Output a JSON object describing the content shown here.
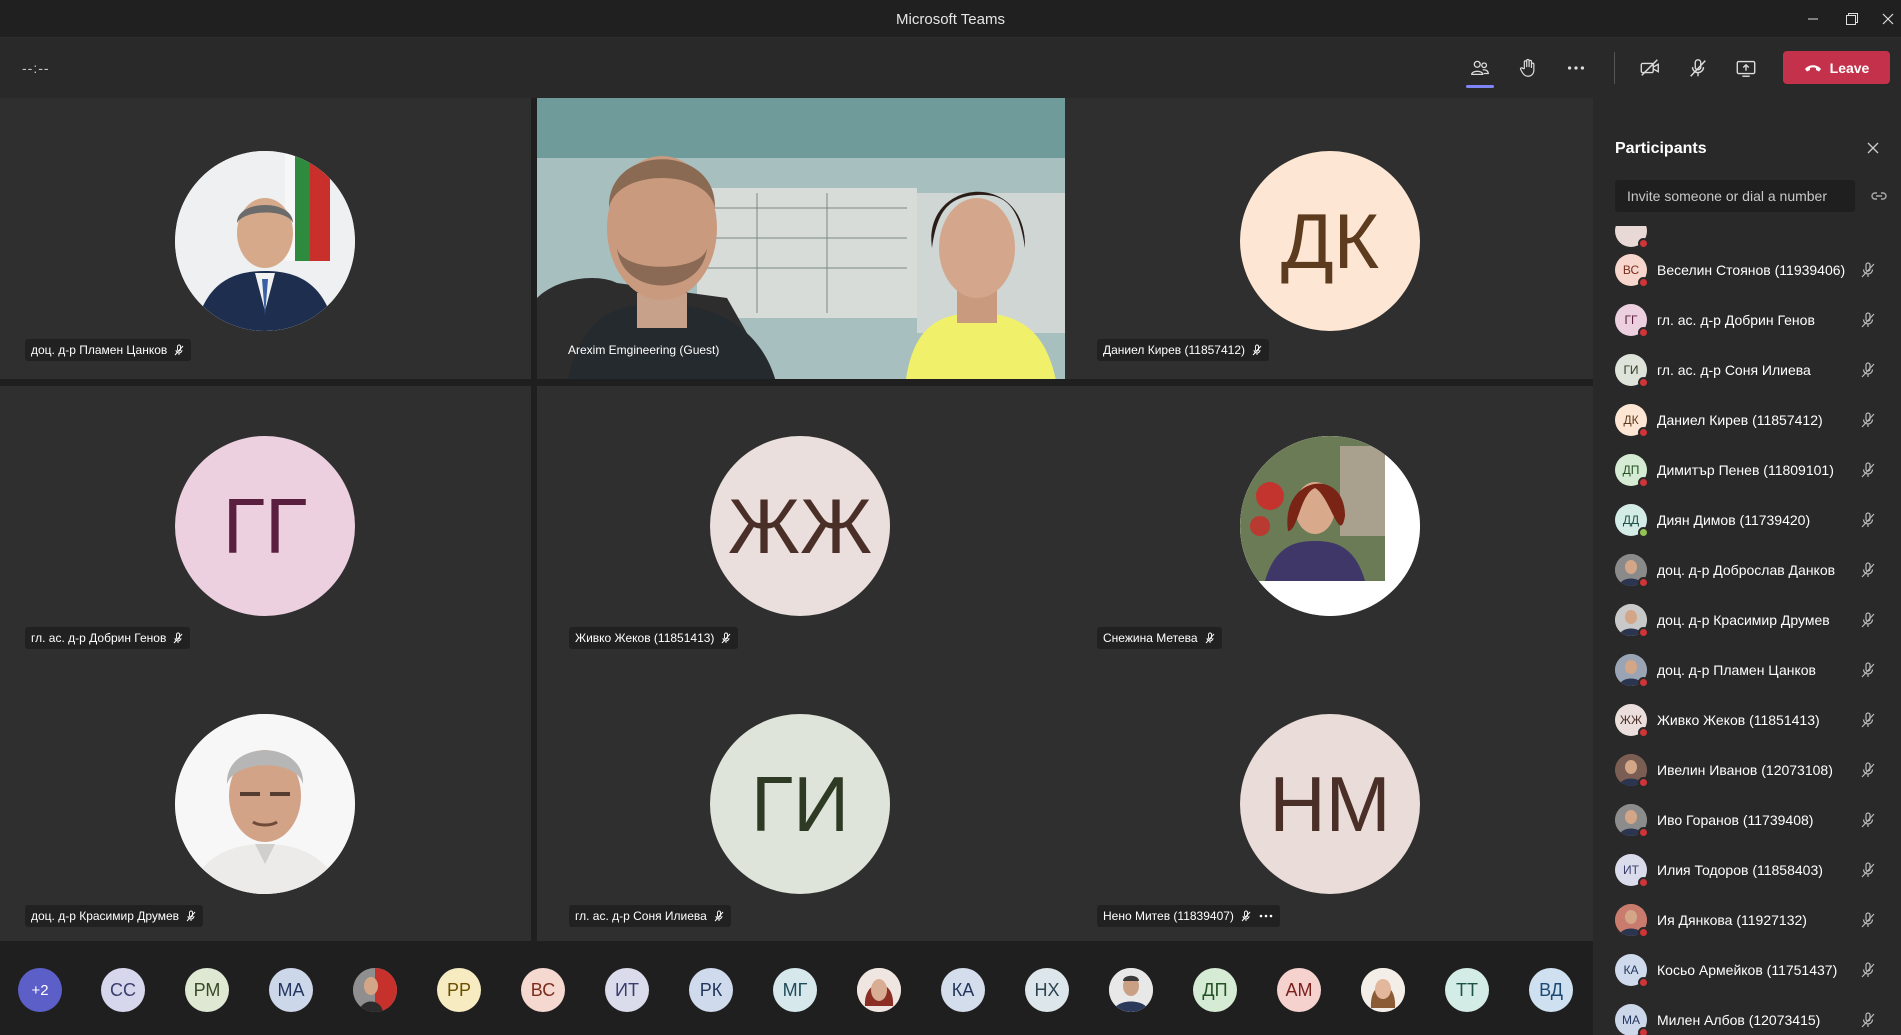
{
  "window": {
    "title": "Microsoft Teams"
  },
  "toolbar": {
    "timer": "--:--",
    "leave_label": "Leave"
  },
  "tiles": [
    {
      "name": "доц. д-р Пламен Цанков",
      "type": "photo"
    },
    {
      "name": "Arexim Emgineering (Guest)",
      "type": "video"
    },
    {
      "name": "Даниел Кирев (11857412)",
      "initials": "ДК",
      "bg": "#fde7d4",
      "fg": "#5c3b1e"
    },
    {
      "name": "гл. ас. д-р Добрин Генов",
      "initials": "ГГ",
      "bg": "#ecd0e0",
      "fg": "#5a1f3e"
    },
    {
      "name": "Живко Жеков (11851413)",
      "initials": "ЖЖ",
      "bg": "#eadfdc",
      "fg": "#4a2f28"
    },
    {
      "name": "Снежина Метева",
      "type": "photo"
    },
    {
      "name": "доц. д-р Красимир Друмев",
      "type": "photo"
    },
    {
      "name": "гл. ас. д-р Соня Илиева",
      "initials": "ГИ",
      "bg": "#dfe4da",
      "fg": "#2f3a24"
    },
    {
      "name": "Нено Митев (11839407)",
      "initials": "НМ",
      "bg": "#eadcd8",
      "fg": "#4a2f28"
    }
  ],
  "overflow_count": "+2",
  "strip": [
    "СС",
    "РМ",
    "МА",
    "",
    "РР",
    "ВС",
    "ИТ",
    "РК",
    "МГ",
    "",
    "КА",
    "НХ",
    "",
    "ДП",
    "АМ",
    "",
    "ТТ",
    "ВД"
  ],
  "participants_panel": {
    "title": "Participants",
    "invite_placeholder": "Invite someone or dial a number",
    "participants": [
      {
        "initials": "ВС",
        "name": "Веселин Стоянов (11939406)"
      },
      {
        "initials": "ГГ",
        "name": "гл. ас. д-р Добрин Генов"
      },
      {
        "initials": "ГИ",
        "name": "гл. ас. д-р Соня Илиева"
      },
      {
        "initials": "ДК",
        "name": "Даниел Кирев (11857412)"
      },
      {
        "initials": "ДП",
        "name": "Димитър Пенев (11809101)"
      },
      {
        "initials": "ДД",
        "name": "Диян Димов (11739420)"
      },
      {
        "initials": "",
        "name": "доц. д-р Доброслав Данков"
      },
      {
        "initials": "",
        "name": "доц. д-р Красимир Друмев"
      },
      {
        "initials": "",
        "name": "доц. д-р Пламен Цанков"
      },
      {
        "initials": "ЖЖ",
        "name": "Живко Жеков (11851413)"
      },
      {
        "initials": "",
        "name": "Ивелин Иванов (12073108)"
      },
      {
        "initials": "",
        "name": "Иво Горанов (11739408)"
      },
      {
        "initials": "ИТ",
        "name": "Илия Тодоров (11858403)"
      },
      {
        "initials": "",
        "name": "Ия Дянкова (11927132)"
      },
      {
        "initials": "КА",
        "name": "Косьо Армейков (11751437)"
      },
      {
        "initials": "МА",
        "name": "Милен Албов (12073415)"
      }
    ]
  }
}
